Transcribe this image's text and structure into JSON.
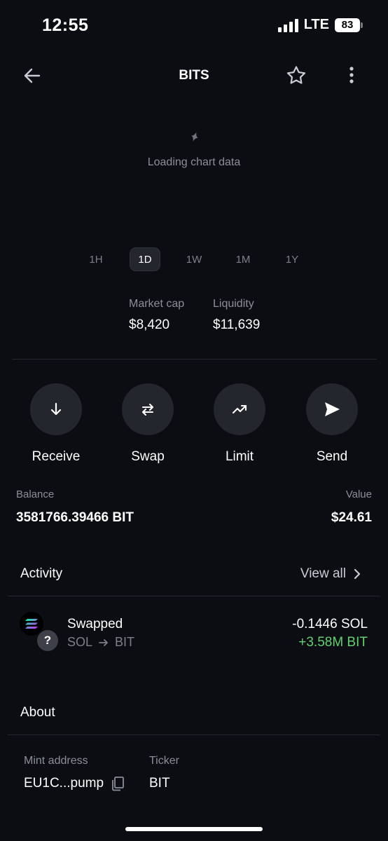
{
  "status_bar": {
    "time": "12:55",
    "network": "LTE",
    "battery": "83"
  },
  "header": {
    "title": "BITS"
  },
  "chart": {
    "loading_text": "Loading chart data"
  },
  "time_ranges": [
    {
      "label": "1H",
      "active": false
    },
    {
      "label": "1D",
      "active": true
    },
    {
      "label": "1W",
      "active": false
    },
    {
      "label": "1M",
      "active": false
    },
    {
      "label": "1Y",
      "active": false
    }
  ],
  "stats": {
    "market_cap": {
      "label": "Market cap",
      "value": "$8,420"
    },
    "liquidity": {
      "label": "Liquidity",
      "value": "$11,639"
    }
  },
  "actions": [
    {
      "label": "Receive",
      "icon": "arrow-down-icon"
    },
    {
      "label": "Swap",
      "icon": "swap-arrows-icon"
    },
    {
      "label": "Limit",
      "icon": "trend-up-icon"
    },
    {
      "label": "Send",
      "icon": "send-icon"
    }
  ],
  "balance": {
    "label": "Balance",
    "amount": "3581766.39466 BIT",
    "value_label": "Value",
    "value": "$24.61"
  },
  "activity": {
    "title": "Activity",
    "view_all": "View all",
    "items": [
      {
        "title": "Swapped",
        "from": "SOL",
        "to": "BIT",
        "amount_out": "-0.1446 SOL",
        "amount_in": "+3.58M BIT",
        "unknown_token_glyph": "?"
      }
    ]
  },
  "about": {
    "title": "About",
    "mint_label": "Mint address",
    "mint_value": "EU1C...pump",
    "ticker_label": "Ticker",
    "ticker_value": "BIT"
  },
  "colors": {
    "background": "#0b0d12",
    "positive": "#5ed36f",
    "muted": "#8a8f99",
    "button": "#23262c"
  }
}
